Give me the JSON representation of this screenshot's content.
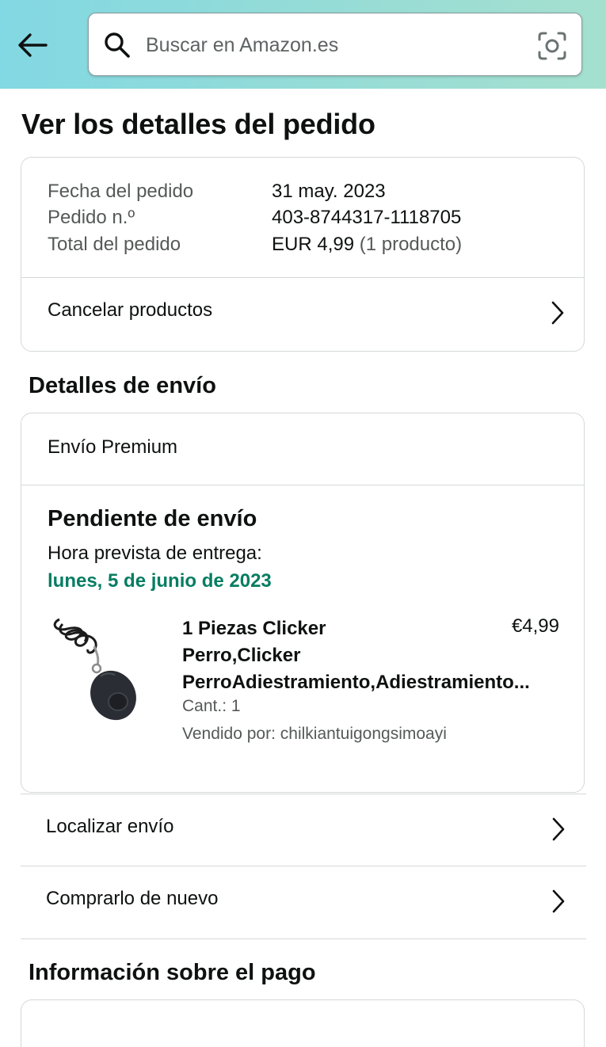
{
  "header": {
    "search_placeholder": "Buscar en Amazon.es",
    "colors": {
      "gradient_start": "#82d8e3",
      "gradient_end": "#a5e0cf"
    }
  },
  "page": {
    "title": "Ver los detalles del pedido"
  },
  "order_summary": {
    "date_label": "Fecha del pedido",
    "date_value": "31 may. 2023",
    "number_label": "Pedido n.º",
    "number_value": "403-8744317-1118705",
    "total_label": "Total del pedido",
    "total_value": "EUR 4,99",
    "total_count": "(1 producto)",
    "cancel_link": "Cancelar productos"
  },
  "shipping": {
    "section_title": "Detalles de envío",
    "method": "Envío Premium",
    "status": "Pendiente de envío",
    "eta_label": "Hora prevista de entrega:",
    "eta_date": "lunes, 5 de junio de 2023",
    "eta_color": "#067d62",
    "product": {
      "title_lines": [
        "1 Piezas Clicker",
        "Perro,Clicker",
        "PerroAdiestramiento,Adiestramiento..."
      ],
      "price": "€4,99",
      "qty": "Cant.: 1",
      "seller": "Vendido por: chilkiantuigongsimoayi"
    }
  },
  "actions": {
    "track": "Localizar envío",
    "buy_again": "Comprarlo de nuevo"
  },
  "payment": {
    "section_title": "Información sobre el pago"
  },
  "icons": [
    "back-arrow-icon",
    "search-icon",
    "camera-lens-icon",
    "chevron-right-icon"
  ]
}
